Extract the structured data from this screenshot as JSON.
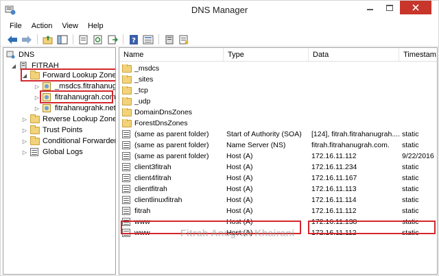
{
  "window": {
    "title": "DNS Manager"
  },
  "menu": [
    "File",
    "Action",
    "View",
    "Help"
  ],
  "toolbar": {
    "buttons": [
      "back-arrow-icon",
      "forward-arrow-icon",
      "up-folder-icon",
      "show-hide-tree-icon",
      "properties-icon",
      "refresh-icon",
      "export-list-icon",
      "help-icon",
      "details-view-icon",
      "server-icon",
      "new-record-icon"
    ]
  },
  "tree": {
    "root": "DNS",
    "server": "FITRAH",
    "forward_zones": "Forward Lookup Zones",
    "zone_msdcs": "_msdcs.fitrahanugrah",
    "zone_main": "fitrahanugrah.com",
    "zone_third": "fitrahanugrahk.net",
    "reverse_zones": "Reverse Lookup Zones",
    "trust_points": "Trust Points",
    "conditional_forwarders": "Conditional Forwarders",
    "global_logs": "Global Logs"
  },
  "list": {
    "columns": [
      "Name",
      "Type",
      "Data",
      "Timestam"
    ],
    "rows": [
      {
        "icon": "folder",
        "name": "_msdcs",
        "type": "",
        "data": "",
        "ts": ""
      },
      {
        "icon": "folder",
        "name": "_sites",
        "type": "",
        "data": "",
        "ts": ""
      },
      {
        "icon": "folder",
        "name": "_tcp",
        "type": "",
        "data": "",
        "ts": ""
      },
      {
        "icon": "folder",
        "name": "_udp",
        "type": "",
        "data": "",
        "ts": ""
      },
      {
        "icon": "folder",
        "name": "DomainDnsZones",
        "type": "",
        "data": "",
        "ts": ""
      },
      {
        "icon": "folder",
        "name": "ForestDnsZones",
        "type": "",
        "data": "",
        "ts": ""
      },
      {
        "icon": "record",
        "name": "(same as parent folder)",
        "type": "Start of Authority (SOA)",
        "data": "[124], fitrah.fitrahanugrah....",
        "ts": "static"
      },
      {
        "icon": "record",
        "name": "(same as parent folder)",
        "type": "Name Server (NS)",
        "data": "fitrah.fitrahanugrah.com.",
        "ts": "static"
      },
      {
        "icon": "record",
        "name": "(same as parent folder)",
        "type": "Host (A)",
        "data": "172.16.11.112",
        "ts": "9/22/2016"
      },
      {
        "icon": "record",
        "name": "client3fitrah",
        "type": "Host (A)",
        "data": "172.16.11.234",
        "ts": "static"
      },
      {
        "icon": "record",
        "name": "client4fitrah",
        "type": "Host (A)",
        "data": "172.16.11.167",
        "ts": "static"
      },
      {
        "icon": "record",
        "name": "clientfitrah",
        "type": "Host (A)",
        "data": "172.16.11.113",
        "ts": "static"
      },
      {
        "icon": "record",
        "name": "clientlinuxfitrah",
        "type": "Host (A)",
        "data": "172.16.11.114",
        "ts": "static"
      },
      {
        "icon": "record",
        "name": "fitrah",
        "type": "Host (A)",
        "data": "172.16.11.112",
        "ts": "static"
      },
      {
        "icon": "record",
        "name": "www",
        "type": "Host (A)",
        "data": "172.16.11.138",
        "ts": "static"
      },
      {
        "icon": "record",
        "name": "www",
        "type": "Host (A)",
        "data": "172.16.11.112",
        "ts": "static"
      }
    ]
  },
  "watermark": "Fitrah Anugrah Khairani",
  "colors": {
    "highlight": "#d4262a",
    "close_button": "#c7352b",
    "folder": "#f2d27a"
  }
}
